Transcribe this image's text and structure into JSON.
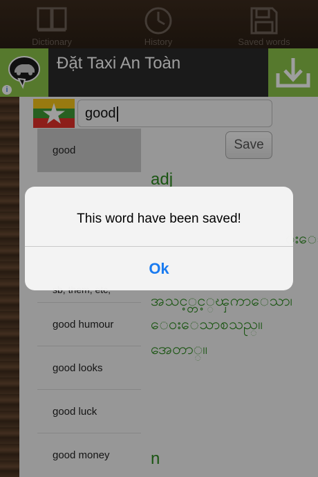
{
  "tabs": [
    {
      "label": "Dictionary",
      "icon": "book-icon"
    },
    {
      "label": "History",
      "icon": "clock-icon"
    },
    {
      "label": "Saved words",
      "icon": "floppy-disk-icon"
    }
  ],
  "ad": {
    "title": "Đặt Taxi An Toàn",
    "info": "i",
    "left_icon": "taxi-chat-icon",
    "right_icon": "download-icon"
  },
  "search": {
    "value": "good",
    "flag_icon": "myanmar-flag-icon"
  },
  "save_button": "Save",
  "word_list": [
    {
      "label": "good",
      "selected": true
    },
    {
      "label": "",
      "selected": false
    },
    {
      "label": "",
      "selected": false
    },
    {
      "label": "sb, them, etc,",
      "selected": false
    },
    {
      "label": "good humour",
      "selected": false
    },
    {
      "label": "good looks",
      "selected": false
    },
    {
      "label": "good luck",
      "selected": false
    },
    {
      "label": "good money",
      "selected": false
    }
  ],
  "definition": {
    "pos_adj": "adj",
    "line_partial": "းေသ",
    "line1": "အသင့္တင့္ၾကာေသာ၊",
    "line2": "ေဝးေသာစသည္။",
    "line3": "အေတာ္။",
    "pos_n": "n"
  },
  "alert": {
    "message": "This word have been saved!",
    "ok": "Ok"
  },
  "colors": {
    "accent_green": "#8bc34a",
    "definition_green": "#2b8a1d",
    "ok_blue": "#1a7bf0"
  }
}
